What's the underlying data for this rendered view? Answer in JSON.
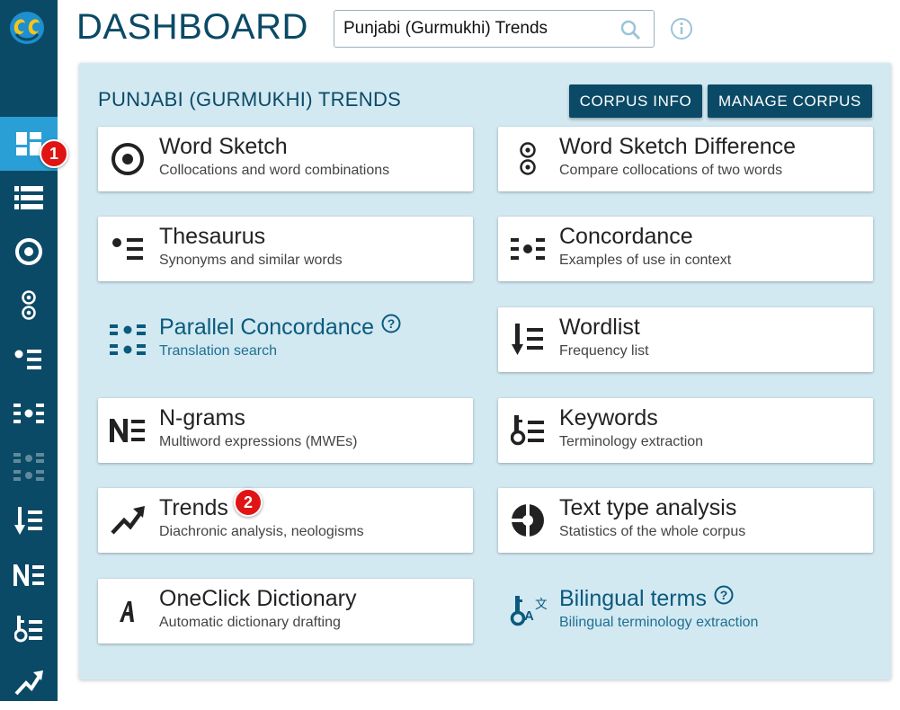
{
  "header": {
    "title": "DASHBOARD",
    "search_value": "Punjabi (Gurmukhi) Trends",
    "search_icon": "search-icon",
    "info_icon": "info-icon"
  },
  "sidebar": {
    "logo": "sketch-engine-logo",
    "items": [
      {
        "icon": "dashboard-icon",
        "active": true
      },
      {
        "icon": "corpus-list-icon"
      },
      {
        "icon": "word-sketch-icon"
      },
      {
        "icon": "word-sketch-difference-icon"
      },
      {
        "icon": "thesaurus-icon"
      },
      {
        "icon": "concordance-icon"
      },
      {
        "icon": "parallel-concordance-icon",
        "disabled": true
      },
      {
        "icon": "wordlist-icon"
      },
      {
        "icon": "ngrams-icon"
      },
      {
        "icon": "keywords-icon"
      },
      {
        "icon": "trends-icon"
      }
    ]
  },
  "panel": {
    "title": "PUNJABI (GURMUKHI) TRENDS",
    "corpus_info_label": "CORPUS INFO",
    "manage_corpus_label": "MANAGE CORPUS"
  },
  "tools": [
    {
      "title": "Word Sketch",
      "subtitle": "Collocations and word combinations",
      "icon": "word-sketch-icon"
    },
    {
      "title": "Word Sketch Difference",
      "subtitle": "Compare collocations of two words",
      "icon": "word-sketch-difference-icon"
    },
    {
      "title": "Thesaurus",
      "subtitle": "Synonyms and similar words",
      "icon": "thesaurus-icon"
    },
    {
      "title": "Concordance",
      "subtitle": "Examples of use in context",
      "icon": "concordance-icon"
    },
    {
      "title": "Parallel Concordance",
      "subtitle": "Translation search",
      "icon": "parallel-concordance-icon",
      "help": true
    },
    {
      "title": "Wordlist",
      "subtitle": "Frequency list",
      "icon": "wordlist-icon"
    },
    {
      "title": "N-grams",
      "subtitle": "Multiword expressions (MWEs)",
      "icon": "ngrams-icon"
    },
    {
      "title": "Keywords",
      "subtitle": "Terminology extraction",
      "icon": "keywords-icon"
    },
    {
      "title": "Trends",
      "subtitle": "Diachronic analysis, neologisms",
      "icon": "trends-icon"
    },
    {
      "title": "Text type analysis",
      "subtitle": "Statistics of the whole corpus",
      "icon": "text-type-analysis-icon"
    },
    {
      "title": "OneClick Dictionary",
      "subtitle": "Automatic dictionary drafting",
      "icon": "oneclick-dictionary-icon"
    },
    {
      "title": "Bilingual terms",
      "subtitle": "Bilingual terminology extraction",
      "icon": "bilingual-terms-icon",
      "help": true
    }
  ],
  "annotations": {
    "badge_1": "1",
    "badge_2": "2"
  },
  "colors": {
    "sidebar": "#0b4a66",
    "active": "#2a9fd6",
    "panel": "#d2e9f2",
    "accent": "#0b4a66",
    "badge": "#e01414"
  }
}
